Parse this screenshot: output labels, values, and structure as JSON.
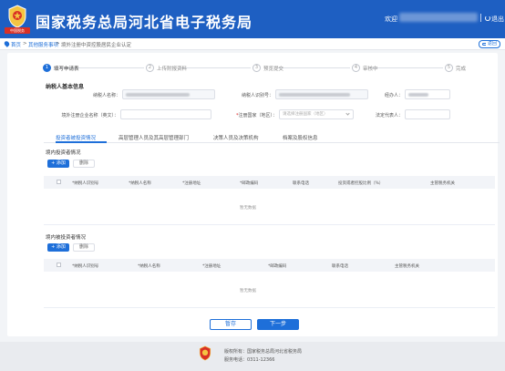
{
  "header": {
    "title": "国家税务总局河北省电子税务局",
    "welcome": "欢迎",
    "user_name": "",
    "logout": "退出",
    "emblem_caption": "中国税务",
    "brand_color": "#1e5fc2"
  },
  "breadcrumb": {
    "home": "首页",
    "sep": ">",
    "level1": "其他服务事项",
    "level2": "境外注册中资控股居民企业认定",
    "back": "返回"
  },
  "steps": [
    {
      "num": "1",
      "label": "填写申请表",
      "active": true
    },
    {
      "num": "2",
      "label": "上传附报资料",
      "active": false
    },
    {
      "num": "3",
      "label": "预览提交",
      "active": false
    },
    {
      "num": "4",
      "label": "审核中",
      "active": false
    },
    {
      "num": "5",
      "label": "完成",
      "active": false
    }
  ],
  "basic_info": {
    "title": "纳税人基本信息",
    "taxpayer_name_label": "纳税人名称：",
    "taxpayer_name_value": "",
    "taxpayer_id_label": "纳税人识别号：",
    "taxpayer_id_value": "",
    "handler_label": "经办人：",
    "handler_value": "",
    "foreign_name_label": "境外注册企业名称（英文）：",
    "foreign_name_placeholder": "",
    "reg_region_label": "注册国家（地区）：",
    "reg_region_placeholder": "请选择注册国家（地区）",
    "legal_rep_label": "法定代表人："
  },
  "tabs": [
    "投资者被投资情况",
    "高层管理人员及其高层管理部门",
    "决策人员及决策机构",
    "档案及股权信息"
  ],
  "domestic_investors": {
    "title": "境内投资者情况",
    "add": "+ 添加",
    "delete": "删除",
    "columns": [
      "*纳税人识别号",
      "*纳税人名称",
      "*注册地址",
      "*邮政编码",
      "联系电话",
      "投资或者控股比例（%）",
      "主管税务机关"
    ],
    "empty": "暂无数据"
  },
  "domestic_investees": {
    "title": "境内被投资者情况",
    "add": "+ 添加",
    "delete": "删除",
    "columns": [
      "*纳税人识别号",
      "*纳税人名称",
      "*注册地址",
      "*邮政编码",
      "联系电话",
      "主管税务机关"
    ],
    "empty": "暂无数据"
  },
  "actions": {
    "save": "暂存",
    "next": "下一步"
  },
  "footer": {
    "copyright": "版权所有：国家税务总局河北省税务局",
    "hotline": "服务电话：0311-12366"
  }
}
